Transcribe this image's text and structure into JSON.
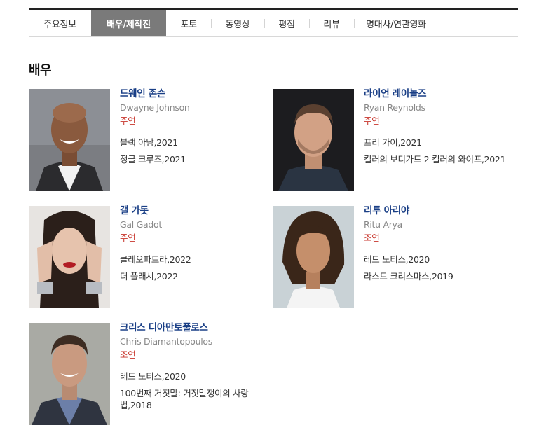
{
  "tabs": [
    {
      "label": "주요정보",
      "active": false
    },
    {
      "label": "배우/제작진",
      "active": true
    },
    {
      "label": "포토",
      "active": false
    },
    {
      "label": "동영상",
      "active": false
    },
    {
      "label": "평점",
      "active": false
    },
    {
      "label": "리뷰",
      "active": false
    },
    {
      "label": "명대사/연관영화",
      "active": false
    }
  ],
  "section_title": "배우",
  "actors": [
    {
      "name_ko": "드웨인 존슨",
      "name_en": "Dwayne Johnson",
      "role": "주연",
      "films": [
        "블랙 아담,2021",
        "정글 크루즈,2021"
      ]
    },
    {
      "name_ko": "라이언 레이놀즈",
      "name_en": "Ryan Reynolds",
      "role": "주연",
      "films": [
        "프리 가이,2021",
        "킬러의 보디가드 2 킬러의 와이프,2021"
      ]
    },
    {
      "name_ko": "갤 가돗",
      "name_en": "Gal Gadot",
      "role": "주연",
      "films": [
        "클레오파트라,2022",
        "더 플래시,2022"
      ]
    },
    {
      "name_ko": "리투 아리야",
      "name_en": "Ritu Arya",
      "role": "조연",
      "films": [
        "레드 노티스,2020",
        "라스트 크리스마스,2019"
      ]
    },
    {
      "name_ko": "크리스 디아만토풀로스",
      "name_en": "Chris Diamantopoulos",
      "role": "조연",
      "films": [
        "레드 노티스,2020",
        "100번째 거짓말: 거짓말쟁이의 사랑법,2018"
      ]
    }
  ]
}
